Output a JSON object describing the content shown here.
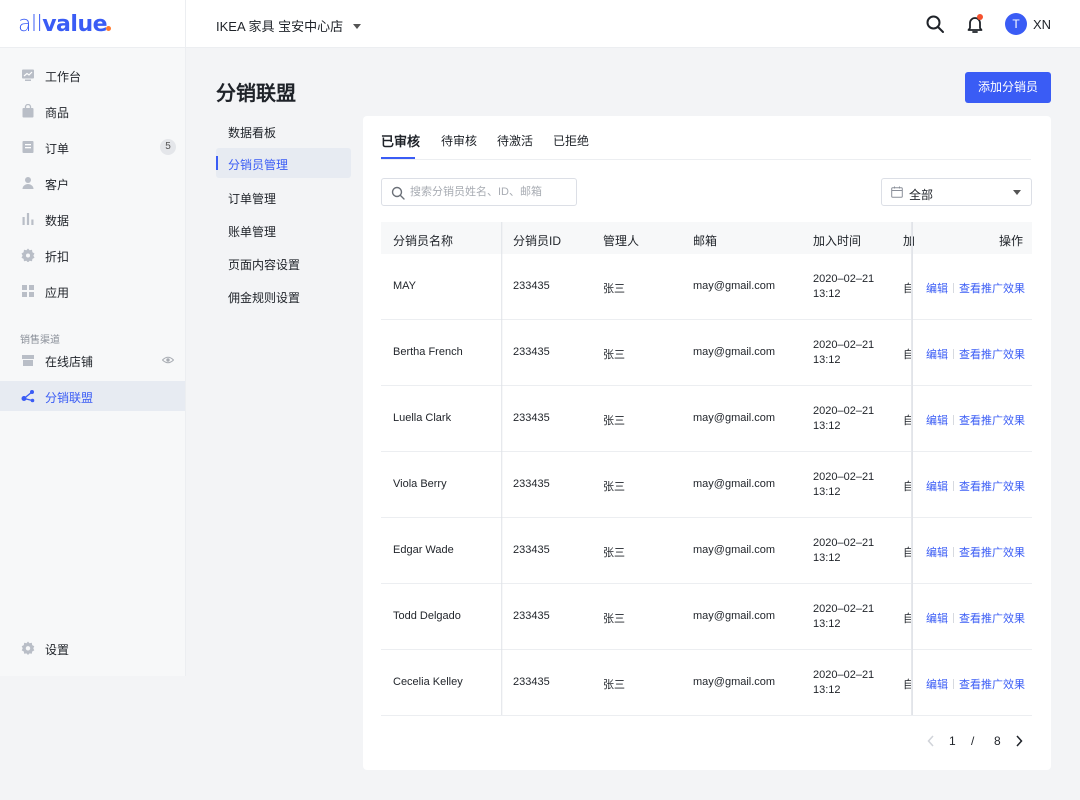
{
  "app": {
    "logo_text_thin": "all",
    "logo_text_bold": "value",
    "brand_color": "#3a5cf5"
  },
  "header": {
    "store_name": "IKEA 家具 宝安中心店",
    "user_initial": "T",
    "user_name": "XN"
  },
  "sidebar": {
    "items": [
      {
        "label": "工作台",
        "icon": "monitor-icon"
      },
      {
        "label": "商品",
        "icon": "shopping-bag-icon"
      },
      {
        "label": "订单",
        "icon": "order-icon",
        "badge": "5"
      },
      {
        "label": "客户",
        "icon": "user-icon"
      },
      {
        "label": "数据",
        "icon": "bar-chart-icon"
      },
      {
        "label": "折扣",
        "icon": "discount-icon"
      },
      {
        "label": "应用",
        "icon": "apps-icon"
      }
    ],
    "section_title": "销售渠道",
    "channels": [
      {
        "label": "在线店铺",
        "icon": "store-icon"
      },
      {
        "label": "分销联盟",
        "icon": "share-icon",
        "active": true
      }
    ],
    "settings_label": "设置"
  },
  "page": {
    "title": "分销联盟",
    "add_button": "添加分销员"
  },
  "subnav": [
    "数据看板",
    "分销员管理",
    "订单管理",
    "账单管理",
    "页面内容设置",
    "佣金规则设置"
  ],
  "subnav_active": "分销员管理",
  "tabs": [
    "已审核",
    "待审核",
    "待激活",
    "已拒绝"
  ],
  "search": {
    "placeholder": "搜索分销员姓名、ID、邮箱"
  },
  "filter": {
    "selected": "全部"
  },
  "table": {
    "headers": {
      "name": "分销员名称",
      "id": "分销员ID",
      "manager": "管理人",
      "email": "邮箱",
      "joined": "加入时间",
      "truncated": "加",
      "actions": "操作"
    },
    "rows": [
      {
        "name": "MAY",
        "id": "233435",
        "manager": "张三",
        "email": "may@gmail.com",
        "date": "2020–02–21",
        "time": "13:12",
        "truncated": "自"
      },
      {
        "name": "Bertha French",
        "id": "233435",
        "manager": "张三",
        "email": "may@gmail.com",
        "date": "2020–02–21",
        "time": "13:12",
        "truncated": "自"
      },
      {
        "name": "Luella Clark",
        "id": "233435",
        "manager": "张三",
        "email": "may@gmail.com",
        "date": "2020–02–21",
        "time": "13:12",
        "truncated": "自"
      },
      {
        "name": "Viola Berry",
        "id": "233435",
        "manager": "张三",
        "email": "may@gmail.com",
        "date": "2020–02–21",
        "time": "13:12",
        "truncated": "自"
      },
      {
        "name": "Edgar Wade",
        "id": "233435",
        "manager": "张三",
        "email": "may@gmail.com",
        "date": "2020–02–21",
        "time": "13:12",
        "truncated": "自"
      },
      {
        "name": "Todd Delgado",
        "id": "233435",
        "manager": "张三",
        "email": "may@gmail.com",
        "date": "2020–02–21",
        "time": "13:12",
        "truncated": "自"
      },
      {
        "name": "Cecelia Kelley",
        "id": "233435",
        "manager": "张三",
        "email": "may@gmail.com",
        "date": "2020–02–21",
        "time": "13:12",
        "truncated": "自"
      }
    ],
    "edit_label": "编辑",
    "view_label": "查看推广效果"
  },
  "pagination": {
    "current": "1",
    "separator": "/",
    "total": "8"
  }
}
